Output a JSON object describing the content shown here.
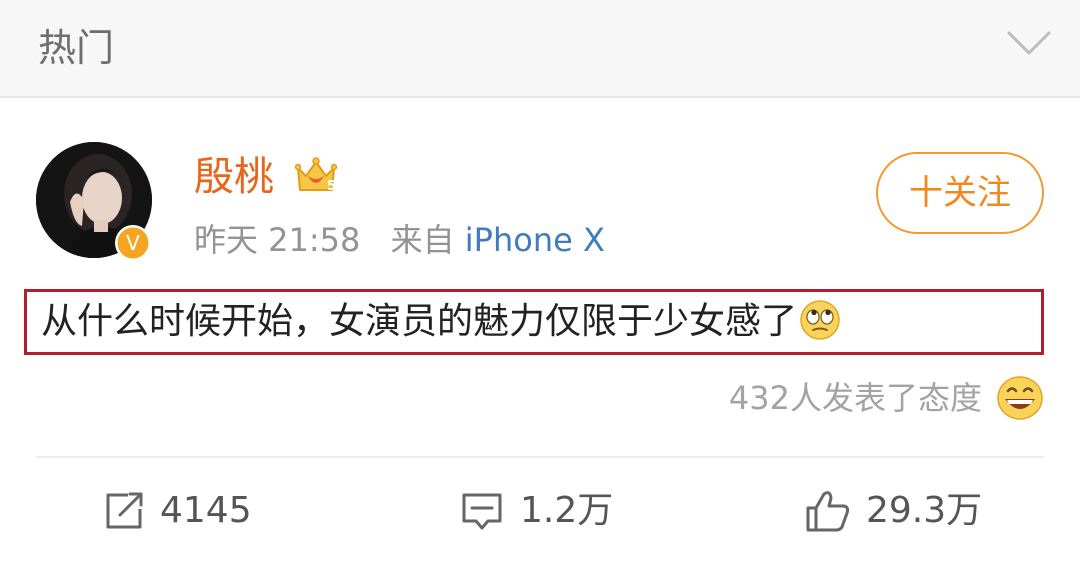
{
  "header": {
    "title": "热门",
    "chevron_icon": "chevron-down-icon"
  },
  "post": {
    "author": {
      "name": "殷桃",
      "avatar_icon": "avatar",
      "verified_icon": "verified-v-icon",
      "member_icon": "crown-member-icon",
      "verified_label": "V",
      "member_level": "5"
    },
    "time": "昨天 21:58",
    "source_prefix": "来自",
    "source": "iPhone X",
    "follow_label": "十关注",
    "text": "从什么时候开始，女演员的魅力仅限于少女感了",
    "text_emoji": "rolling-eyes-emoji",
    "reactions_text": "432人发表了态度",
    "reaction_emoji": "grin-emoji"
  },
  "actions": {
    "repost": {
      "icon": "repost-icon",
      "count": "4145"
    },
    "comment": {
      "icon": "comment-icon",
      "count": "1.2万"
    },
    "like": {
      "icon": "thumbs-up-icon",
      "count": "29.3万"
    }
  },
  "colors": {
    "username": "#e8661c",
    "follow": "#f0881f",
    "source_link": "#3f7bbd",
    "highlight_box": "#b31d2d",
    "meta_gray": "#939393"
  }
}
